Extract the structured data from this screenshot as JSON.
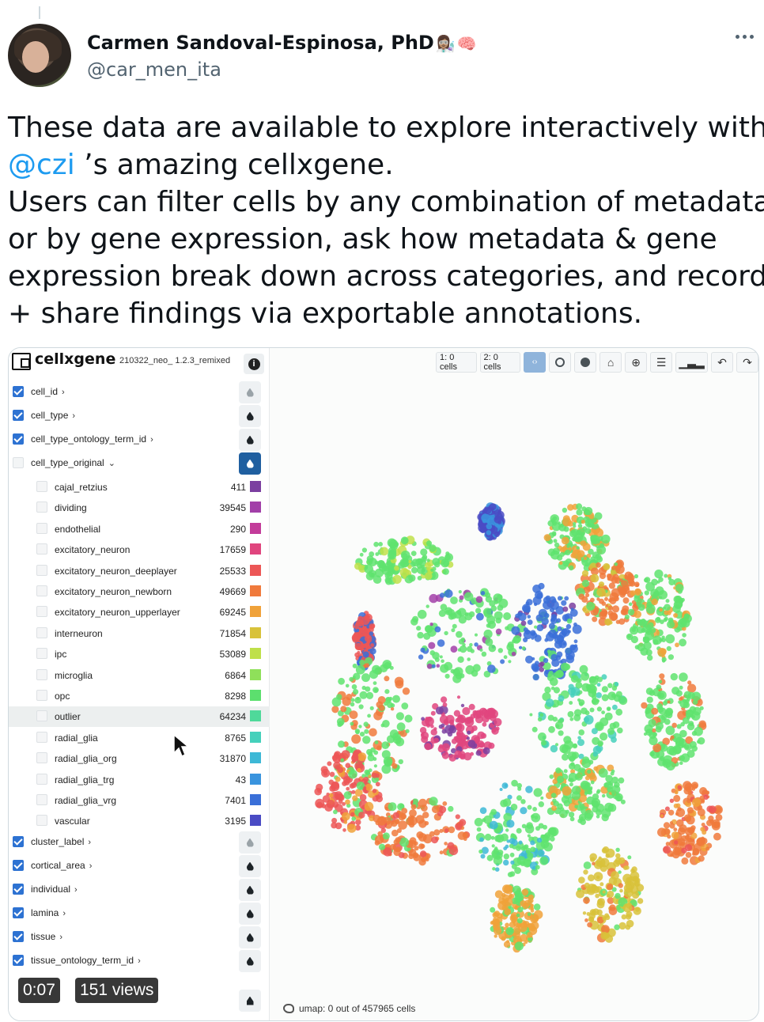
{
  "tweet": {
    "display_name": "Carmen Sandoval-Espinosa, PhD",
    "name_emojis": [
      "👩🏽‍🔬",
      "🧠"
    ],
    "handle": "@car_men_ita",
    "text_lines": [
      {
        "pre": "These data are available to explore interactively with",
        "mention": "",
        "post": ""
      },
      {
        "pre": "",
        "mention": "@czi",
        "post": " ’s amazing cellxgene."
      },
      {
        "pre": "Users can filter cells by any combination of metadata",
        "mention": "",
        "post": ""
      },
      {
        "pre": "or by gene expression, ask how metadata & gene",
        "mention": "",
        "post": ""
      },
      {
        "pre": "expression break down across categories, and  record",
        "mention": "",
        "post": ""
      },
      {
        "pre": "+ share findings via exportable annotations.",
        "mention": "",
        "post": ""
      }
    ]
  },
  "video": {
    "time": "0:07",
    "views": "151 views"
  },
  "cellxgene": {
    "app_title": "cellxgene",
    "dataset_name": "210322_neo_ 1.2.3_remixed",
    "toolbar": {
      "cells_1": "1: 0 cells",
      "cells_2": "2: 0 cells"
    },
    "categories_top": [
      {
        "label": "cell_id",
        "checked": true,
        "chevron": "›",
        "button": "faded"
      },
      {
        "label": "cell_type",
        "checked": true,
        "chevron": "›",
        "button": "normal"
      },
      {
        "label": "cell_type_ontology_term_id",
        "checked": true,
        "chevron": "›",
        "button": "normal"
      },
      {
        "label": "cell_type_original",
        "checked": false,
        "chevron": "⌄",
        "button": "active"
      }
    ],
    "values": [
      {
        "label": "cajal_retzius",
        "count": "411",
        "color": "#7b3fa0"
      },
      {
        "label": "dividing",
        "count": "39545",
        "color": "#a23fa8"
      },
      {
        "label": "endothelial",
        "count": "290",
        "color": "#c33c9a"
      },
      {
        "label": "excitatory_neuron",
        "count": "17659",
        "color": "#e0457e"
      },
      {
        "label": "excitatory_neuron_deeplayer",
        "count": "25533",
        "color": "#ec5656"
      },
      {
        "label": "excitatory_neuron_newborn",
        "count": "49669",
        "color": "#f07a3c"
      },
      {
        "label": "excitatory_neuron_upperlayer",
        "count": "69245",
        "color": "#f0a23a"
      },
      {
        "label": "interneuron",
        "count": "71854",
        "color": "#d8c23a"
      },
      {
        "label": "ipc",
        "count": "53089",
        "color": "#bfe04a"
      },
      {
        "label": "microglia",
        "count": "6864",
        "color": "#8fe05a"
      },
      {
        "label": "opc",
        "count": "8298",
        "color": "#5cdf6e"
      },
      {
        "label": "outlier",
        "count": "64234",
        "color": "#4fd99a"
      },
      {
        "label": "radial_glia",
        "count": "8765",
        "color": "#45d0bb"
      },
      {
        "label": "radial_glia_org",
        "count": "31870",
        "color": "#3db8d6"
      },
      {
        "label": "radial_glia_trg",
        "count": "43",
        "color": "#3a94de"
      },
      {
        "label": "radial_glia_vrg",
        "count": "7401",
        "color": "#3a6fd8"
      },
      {
        "label": "vascular",
        "count": "3195",
        "color": "#4a4bc4"
      }
    ],
    "categories_bottom": [
      {
        "label": "cluster_label",
        "checked": true,
        "chevron": "›",
        "button": "faded"
      },
      {
        "label": "cortical_area",
        "checked": true,
        "chevron": "›",
        "button": "normal"
      },
      {
        "label": "individual",
        "checked": true,
        "chevron": "›",
        "button": "normal"
      },
      {
        "label": "lamina",
        "checked": true,
        "chevron": "›",
        "button": "normal"
      },
      {
        "label": "tissue",
        "checked": true,
        "chevron": "›",
        "button": "normal"
      },
      {
        "label": "tissue_ontology_term_id",
        "checked": true,
        "chevron": "›",
        "button": "normal"
      }
    ],
    "footer": "umap: 0 out of 457965 cells"
  }
}
